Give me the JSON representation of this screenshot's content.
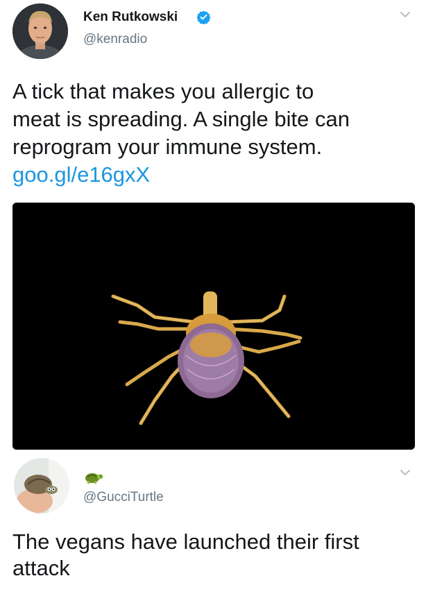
{
  "tweet": {
    "author_name": "Ken Rutkowski",
    "handle": "@kenradio",
    "verified_icon": "verified-badge-icon",
    "text_lines": [
      "A tick that makes you allergic to",
      "meat is spreading. A single bite can",
      "reprogram your immune system."
    ],
    "link": "goo.gl/e16gxX",
    "link_color": "#1b95e0",
    "verified_color": "#1da1f2"
  },
  "reply": {
    "name_icon": "turtle-emoji-icon",
    "handle": "@GucciTurtle",
    "text_lines": [
      "The vegans have launched their first",
      "attack"
    ]
  }
}
